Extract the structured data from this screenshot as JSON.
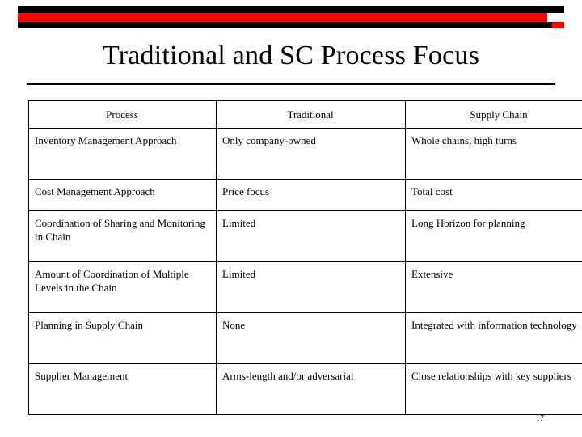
{
  "slide": {
    "title": "Traditional and SC Process Focus",
    "page_number": "17",
    "accent_color": "#ff0000",
    "rule_color": "#000000"
  },
  "table": {
    "headers": [
      "Process",
      "Traditional",
      "Supply Chain"
    ],
    "rows": [
      {
        "process": "Inventory Management Approach",
        "traditional": "Only company-owned",
        "supply_chain": "Whole chains, high turns"
      },
      {
        "process": "Cost Management Approach",
        "traditional": "Price focus",
        "supply_chain": "Total cost"
      },
      {
        "process": "Coordination of Sharing and Monitoring in Chain",
        "traditional": "Limited",
        "supply_chain": "Long Horizon for planning"
      },
      {
        "process": "Amount of Coordination of Multiple Levels in the Chain",
        "traditional": "Limited",
        "supply_chain": "Extensive"
      },
      {
        "process": "Planning in Supply Chain",
        "traditional": "None",
        "supply_chain": "Integrated with information technology"
      },
      {
        "process": "Supplier Management",
        "traditional": "Arms-length and/or adversarial",
        "supply_chain": "Close relationships with key suppliers"
      }
    ]
  }
}
